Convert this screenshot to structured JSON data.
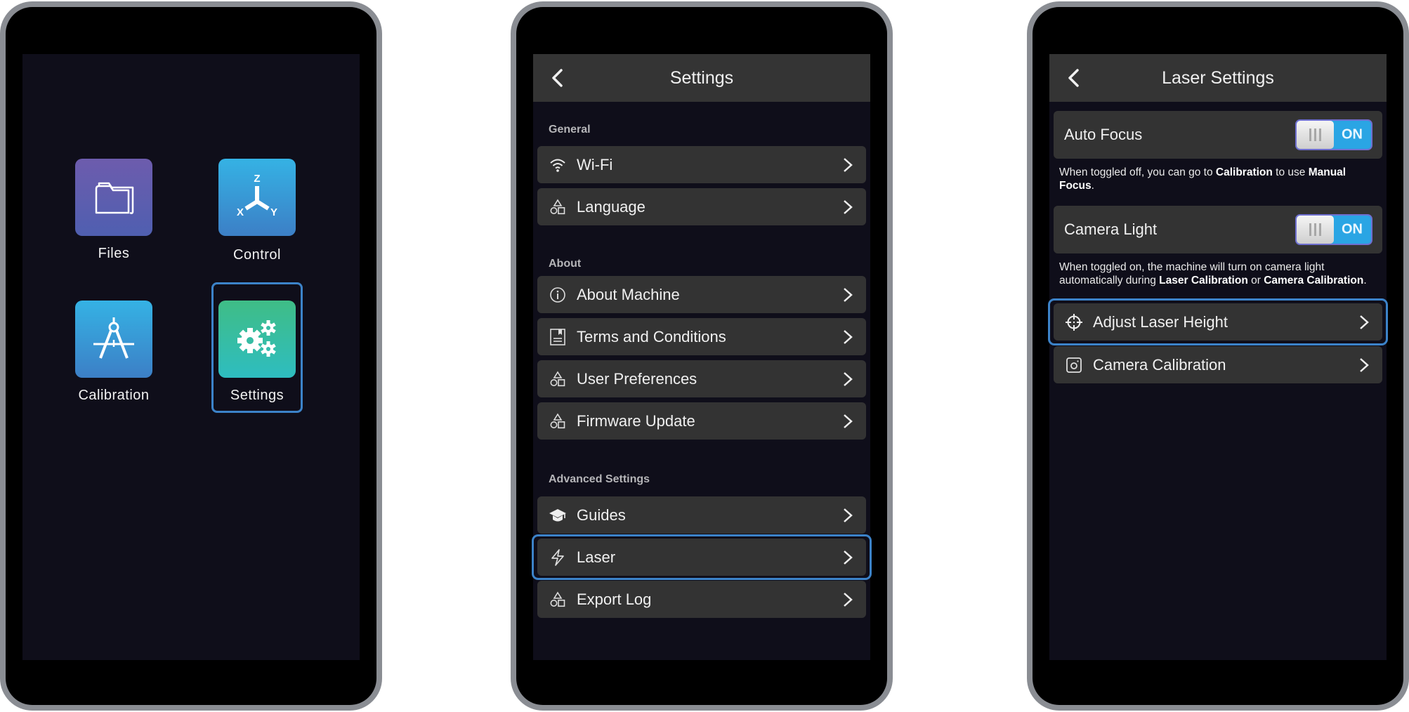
{
  "home_screen": {
    "apps": [
      {
        "label": "Files",
        "icon": "folder-icon"
      },
      {
        "label": "Control",
        "icon": "xyz-axes-icon",
        "axes": {
          "z": "Z",
          "x": "X",
          "y": "Y"
        }
      },
      {
        "label": "Calibration",
        "icon": "compass-icon"
      },
      {
        "label": "Settings",
        "icon": "gears-icon",
        "highlighted": true
      }
    ],
    "colors": {
      "files": "#5b5fb0",
      "control": "#369ad6",
      "calibration": "#369ad6",
      "settings": "#35bda3",
      "highlight": "#3c83c9"
    }
  },
  "settings_screen": {
    "title": "Settings",
    "sections": [
      {
        "label": "General",
        "items": [
          {
            "label": "Wi-Fi",
            "icon": "wifi-icon"
          },
          {
            "label": "Language",
            "icon": "shapes-icon"
          }
        ]
      },
      {
        "label": "About",
        "items": [
          {
            "label": "About Machine",
            "icon": "info-icon"
          },
          {
            "label": "Terms and Conditions",
            "icon": "document-icon"
          },
          {
            "label": "User Preferences",
            "icon": "shapes-icon"
          },
          {
            "label": "Firmware Update",
            "icon": "shapes-icon"
          }
        ]
      },
      {
        "label": "Advanced Settings",
        "items": [
          {
            "label": "Guides",
            "icon": "graduation-cap-icon"
          },
          {
            "label": "Laser",
            "icon": "lightning-icon",
            "highlighted": true
          },
          {
            "label": "Export Log",
            "icon": "shapes-icon"
          }
        ]
      }
    ]
  },
  "laser_screen": {
    "title": "Laser Settings",
    "toggles": [
      {
        "label": "Auto Focus",
        "state": "ON",
        "on": true,
        "note_parts": [
          "When toggled off, you can go to ",
          "Calibration",
          " to use ",
          "Manual Focus",
          "."
        ]
      },
      {
        "label": "Camera Light",
        "state": "ON",
        "on": true,
        "note_parts": [
          "When toggled on, the machine will turn on camera light automatically during ",
          "Laser Calibration",
          " or ",
          "Camera Calibration",
          "."
        ]
      }
    ],
    "items": [
      {
        "label": "Adjust Laser Height",
        "icon": "crosshair-icon",
        "highlighted": true
      },
      {
        "label": "Camera Calibration",
        "icon": "camera-icon"
      }
    ],
    "colors": {
      "toggle_on": "#2aa5e4"
    }
  }
}
